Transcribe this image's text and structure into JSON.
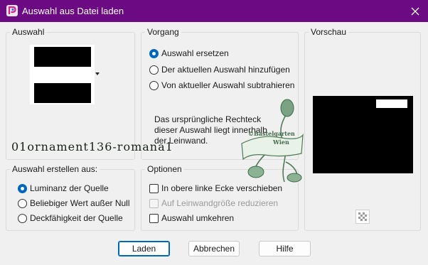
{
  "window": {
    "title": "Auswahl aus Datei laden",
    "accent": "#6c0a84"
  },
  "auswahl": {
    "group_title": "Auswahl"
  },
  "vorgang": {
    "group_title": "Vorgang",
    "options": [
      {
        "label": "Auswahl ersetzen",
        "selected": true
      },
      {
        "label": "Der aktuellen Auswahl hinzufügen",
        "selected": false
      },
      {
        "label": "Von aktueller Auswahl subtrahieren",
        "selected": false
      }
    ],
    "info_text": "Das ursprüngliche Rechteck dieser Auswahl liegt innerhalb der Leinwand."
  },
  "vorschau": {
    "group_title": "Vorschau"
  },
  "erstellen": {
    "group_title": "Auswahl erstellen aus:",
    "options": [
      {
        "label": "Luminanz der Quelle",
        "selected": true
      },
      {
        "label": "Beliebiger Wert außer Null",
        "selected": false
      },
      {
        "label": "Deckfähigkeit der Quelle",
        "selected": false
      }
    ]
  },
  "optionen": {
    "group_title": "Optionen",
    "checkboxes": [
      {
        "label": "In obere linke Ecke verschieben",
        "checked": false,
        "enabled": true
      },
      {
        "label": "Auf Leinwandgröße reduzieren",
        "checked": false,
        "enabled": false
      },
      {
        "label": "Auswahl umkehren",
        "checked": false,
        "enabled": true
      }
    ]
  },
  "buttons": {
    "load": "Laden",
    "cancel": "Abbrechen",
    "help": "Hilfe"
  },
  "overlay": {
    "filename": "01ornament136-romana1",
    "stamp_line1": "©Bastelgarten",
    "stamp_line2": "Wien"
  }
}
